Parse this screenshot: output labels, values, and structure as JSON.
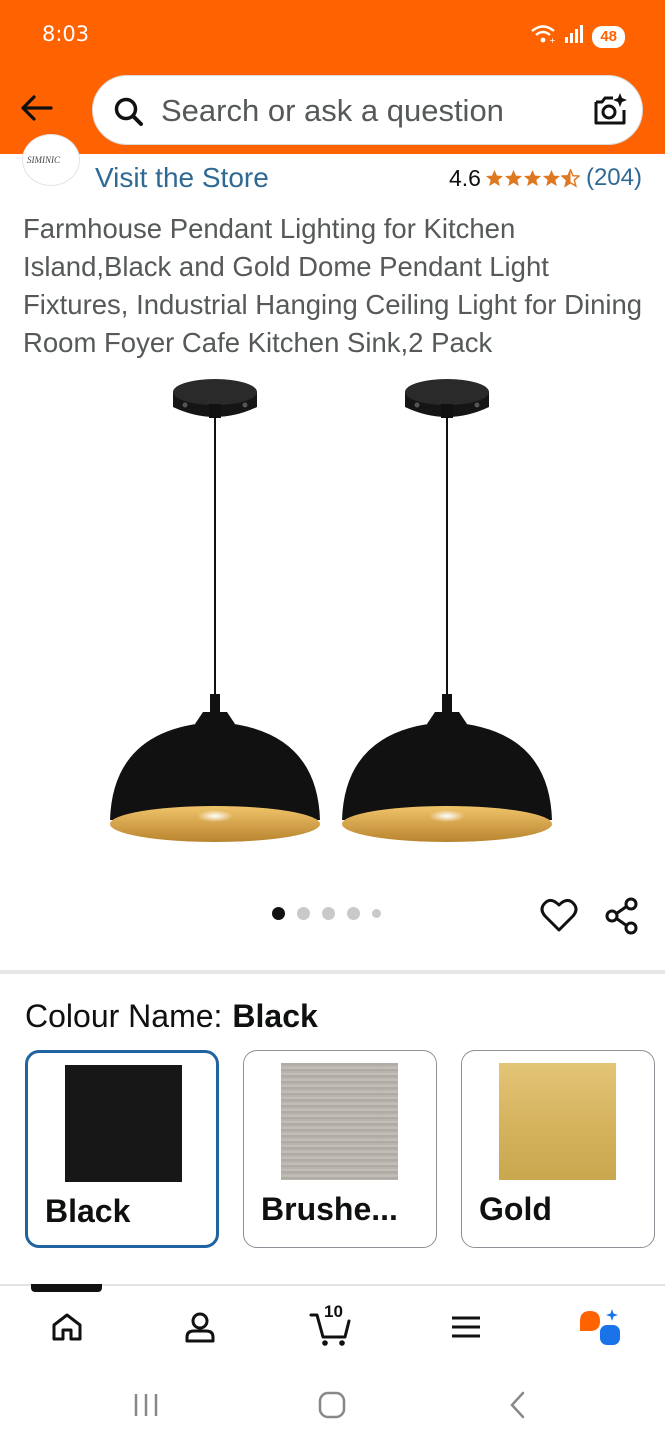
{
  "status_bar": {
    "time": "8:03",
    "battery": "48",
    "icons": [
      "wifi-icon",
      "signal-icon",
      "battery-icon"
    ]
  },
  "header": {
    "back_icon": "arrow-left-icon",
    "search_placeholder": "Search or ask a question",
    "camera_icon": "camera-sparkle-icon"
  },
  "store": {
    "logo_text": "SIMINIC",
    "link_label": "Visit the Store",
    "rating": "4.6",
    "stars": 4.6,
    "rating_count": "(204)"
  },
  "product": {
    "title": "Farmhouse Pendant Lighting for Kitchen Island,Black and Gold Dome Pendant Light Fixtures, Industrial Hanging Ceiling Light for Dining Room Foyer Cafe Kitchen Sink,2 Pack",
    "image_count": 5,
    "active_image_index": 0
  },
  "colour": {
    "label": "Colour Name:",
    "selected": "Black",
    "options": [
      {
        "name": "Black",
        "swatch_color": "#161716",
        "selected": true
      },
      {
        "name": "Brushe...",
        "swatch_color": "#b8b5ae",
        "selected": false
      },
      {
        "name": "Gold",
        "swatch_color": "#d6b45f",
        "selected": false
      }
    ]
  },
  "bottom_nav": {
    "items": [
      "home-icon",
      "account-icon",
      "cart-icon",
      "menu-icon",
      "rufus-icon"
    ],
    "cart_count": "10"
  },
  "system_nav": [
    "recent-apps-icon",
    "home-button-icon",
    "back-button-icon"
  ],
  "colors": {
    "brand_orange": "#ff6200",
    "link_blue": "#2f6a95",
    "star_orange": "#de7921",
    "selected_border": "#2162a1"
  }
}
